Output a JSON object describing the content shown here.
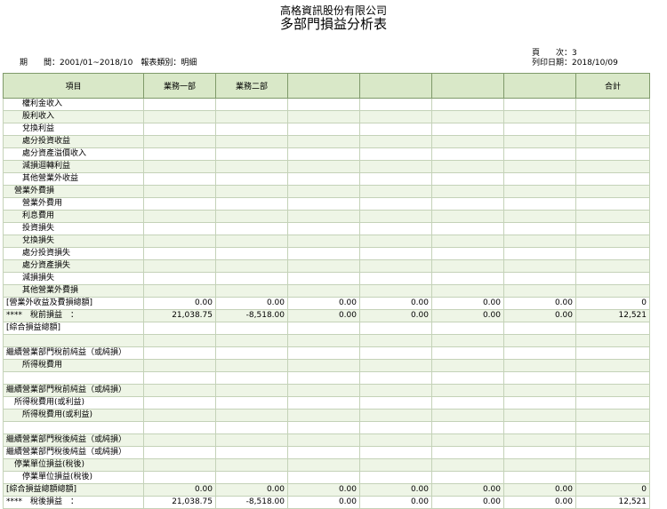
{
  "header": {
    "company": "高格資訊股份有限公司",
    "title": "多部門損益分析表",
    "page_text": "頁　　次：3",
    "print_date_text": "列印日期：2018/10/09",
    "period_text": "期　　間：2001/01~2018/10　報表類別：明細"
  },
  "table": {
    "columns": [
      "項目",
      "業務一部",
      "業務二部",
      "",
      "",
      "",
      "",
      "合計"
    ],
    "rows": [
      {
        "label": "　　權利金收入",
        "values": [
          "",
          "",
          "",
          "",
          "",
          "",
          ""
        ]
      },
      {
        "label": "　　股利收入",
        "values": [
          "",
          "",
          "",
          "",
          "",
          "",
          ""
        ]
      },
      {
        "label": "　　兌換利益",
        "values": [
          "",
          "",
          "",
          "",
          "",
          "",
          ""
        ]
      },
      {
        "label": "　　處分投資收益",
        "values": [
          "",
          "",
          "",
          "",
          "",
          "",
          ""
        ]
      },
      {
        "label": "　　處分資產溢價收入",
        "values": [
          "",
          "",
          "",
          "",
          "",
          "",
          ""
        ]
      },
      {
        "label": "　　減損迴轉利益",
        "values": [
          "",
          "",
          "",
          "",
          "",
          "",
          ""
        ]
      },
      {
        "label": "　　其他營業外收益",
        "values": [
          "",
          "",
          "",
          "",
          "",
          "",
          ""
        ]
      },
      {
        "label": "　營業外費損",
        "values": [
          "",
          "",
          "",
          "",
          "",
          "",
          ""
        ]
      },
      {
        "label": "　　營業外費用",
        "values": [
          "",
          "",
          "",
          "",
          "",
          "",
          ""
        ]
      },
      {
        "label": "　　利息費用",
        "values": [
          "",
          "",
          "",
          "",
          "",
          "",
          ""
        ]
      },
      {
        "label": "　　投資損失",
        "values": [
          "",
          "",
          "",
          "",
          "",
          "",
          ""
        ]
      },
      {
        "label": "　　兌換損失",
        "values": [
          "",
          "",
          "",
          "",
          "",
          "",
          ""
        ]
      },
      {
        "label": "　　處分投資損失",
        "values": [
          "",
          "",
          "",
          "",
          "",
          "",
          ""
        ]
      },
      {
        "label": "　　處分資產損失",
        "values": [
          "",
          "",
          "",
          "",
          "",
          "",
          ""
        ]
      },
      {
        "label": "　　減損損失",
        "values": [
          "",
          "",
          "",
          "",
          "",
          "",
          ""
        ]
      },
      {
        "label": "　　其他營業外費損",
        "values": [
          "",
          "",
          "",
          "",
          "",
          "",
          ""
        ]
      },
      {
        "label": "[營業外收益及費損總額]",
        "values": [
          "0.00",
          "0.00",
          "0.00",
          "0.00",
          "0.00",
          "0.00",
          "0"
        ]
      },
      {
        "label": "****　稅前損益　：",
        "values": [
          "21,038.75",
          "-8,518.00",
          "0.00",
          "0.00",
          "0.00",
          "0.00",
          "12,521"
        ]
      },
      {
        "label": "[綜合損益總額]",
        "values": [
          "",
          "",
          "",
          "",
          "",
          "",
          ""
        ]
      },
      {
        "label": "",
        "values": [
          "",
          "",
          "",
          "",
          "",
          "",
          ""
        ]
      },
      {
        "label": "繼續營業部門稅前純益（或純損）",
        "values": [
          "",
          "",
          "",
          "",
          "",
          "",
          ""
        ]
      },
      {
        "label": "　　所得稅費用",
        "values": [
          "",
          "",
          "",
          "",
          "",
          "",
          ""
        ]
      },
      {
        "label": "",
        "values": [
          "",
          "",
          "",
          "",
          "",
          "",
          ""
        ]
      },
      {
        "label": "繼續營業部門稅前純益（或純損）",
        "values": [
          "",
          "",
          "",
          "",
          "",
          "",
          ""
        ]
      },
      {
        "label": "　所得稅費用(或利益)",
        "values": [
          "",
          "",
          "",
          "",
          "",
          "",
          ""
        ]
      },
      {
        "label": "　　所得稅費用(或利益)",
        "values": [
          "",
          "",
          "",
          "",
          "",
          "",
          ""
        ]
      },
      {
        "label": "",
        "values": [
          "",
          "",
          "",
          "",
          "",
          "",
          ""
        ]
      },
      {
        "label": "繼續營業部門稅後純益（或純損）",
        "values": [
          "",
          "",
          "",
          "",
          "",
          "",
          ""
        ]
      },
      {
        "label": "繼續營業部門稅後純益（或純損）",
        "values": [
          "",
          "",
          "",
          "",
          "",
          "",
          ""
        ]
      },
      {
        "label": "　停業單位損益(稅後)",
        "values": [
          "",
          "",
          "",
          "",
          "",
          "",
          ""
        ]
      },
      {
        "label": "　　停業單位損益(稅後)",
        "values": [
          "",
          "",
          "",
          "",
          "",
          "",
          ""
        ]
      },
      {
        "label": "[綜合損益總額總額]",
        "values": [
          "0.00",
          "0.00",
          "0.00",
          "0.00",
          "0.00",
          "0.00",
          "0"
        ]
      },
      {
        "label": "****　稅後損益　：",
        "values": [
          "21,038.75",
          "-8,518.00",
          "0.00",
          "0.00",
          "0.00",
          "0.00",
          "12,521"
        ]
      }
    ]
  }
}
